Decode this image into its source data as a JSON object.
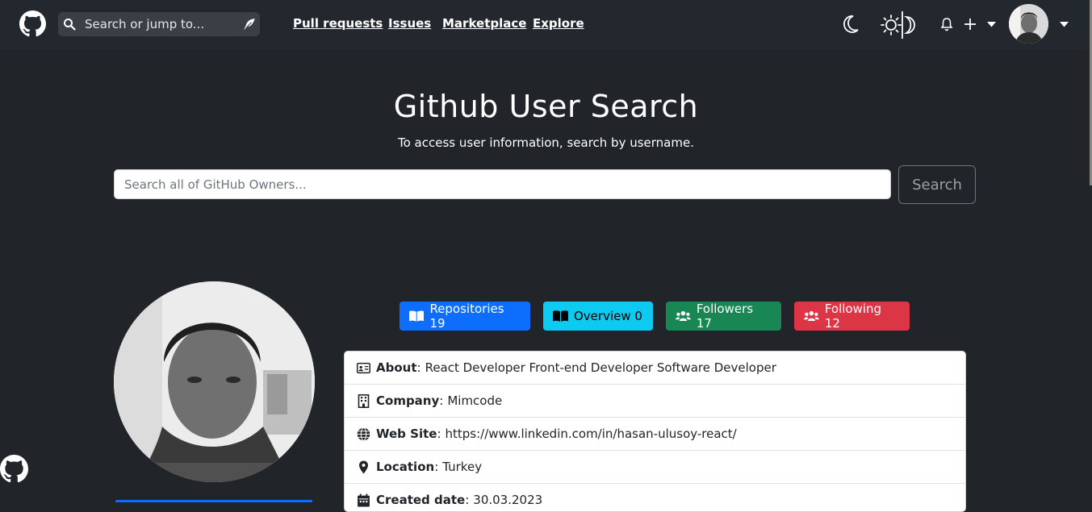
{
  "topbar": {
    "search_placeholder": "Search or jump to...",
    "nav": [
      "Pull requests",
      "Issues",
      "Marketplace",
      "Explore"
    ],
    "icons": [
      "github-logo-icon",
      "moon-icon",
      "sun-moon-icon",
      "bell-icon",
      "plus-icon",
      "caret-down-icon"
    ]
  },
  "hero": {
    "title": "Github User Search",
    "subtitle": "To access user information, search by username."
  },
  "search": {
    "placeholder": "Search all of GitHub Owners...",
    "button": "Search"
  },
  "stats": {
    "repositories": "Repositories 19",
    "overview": "Overview 0",
    "followers": "Followers 17",
    "following": "Following 12"
  },
  "colors": {
    "repositories": "#0d6efd",
    "overview": "#0dcaf0",
    "followers": "#198754",
    "following": "#dc3545",
    "background": "#212529"
  },
  "info": {
    "about_label": "About",
    "about_value": "React Developer Front-end Developer Software Developer",
    "company_label": "Company",
    "company_value": "Mimcode",
    "website_label": "Web Site",
    "website_value": "https://www.linkedin.com/in/hasan-ulusoy-react/",
    "location_label": "Location",
    "location_value": "Turkey",
    "created_label": "Created date",
    "created_value": "30.03.2023"
  }
}
